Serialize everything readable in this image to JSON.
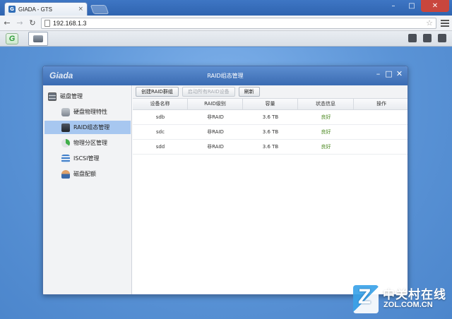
{
  "browser": {
    "tab_title": "GIADA - GTS",
    "tab_favicon": "G",
    "url": "192.168.1.3"
  },
  "appbar": {
    "logo_text": "G"
  },
  "window": {
    "brand": "Giada",
    "title": "RAID组态管理"
  },
  "sidebar": {
    "items": [
      {
        "label": "磁盘管理",
        "icon": "server-icon"
      },
      {
        "label": "硬盘物理特性",
        "icon": "hdd-icon"
      },
      {
        "label": "RAID组态管理",
        "icon": "raid-icon"
      },
      {
        "label": "物理分区管理",
        "icon": "partition-icon"
      },
      {
        "label": "ISCSI管理",
        "icon": "iscsi-icon"
      },
      {
        "label": "磁盘配额",
        "icon": "quota-user-icon"
      }
    ]
  },
  "toolbar": {
    "create_label": "创建RAID群组",
    "start_all_label": "启动所有RAID设备",
    "refresh_label": "刷新"
  },
  "table": {
    "headers": [
      "设备名称",
      "RAID级别",
      "容量",
      "状态信息",
      "操作"
    ],
    "rows": [
      [
        "sdb",
        "非RAID",
        "3.6 TB",
        "良好",
        ""
      ],
      [
        "sdc",
        "非RAID",
        "3.6 TB",
        "良好",
        ""
      ],
      [
        "sdd",
        "非RAID",
        "3.6 TB",
        "良好",
        ""
      ]
    ]
  },
  "watermark": {
    "badge": "Z",
    "cn": "中关村在线",
    "en": "ZOL.COM.CN"
  }
}
